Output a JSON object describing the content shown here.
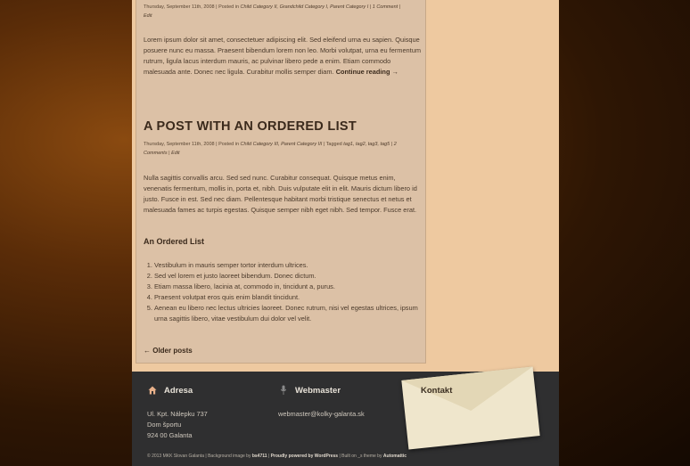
{
  "post1": {
    "meta_date": "Thursday, September 11th, 2008 | Posted in ",
    "meta_cats": "Child Category II, Grandchild Category I, Parent Category I",
    "meta_sep": " | ",
    "meta_comments": "1 Comment",
    "meta_edit": "Edit",
    "excerpt": "Lorem ipsum dolor sit amet, consectetuer adipiscing elit. Sed eleifend urna eu sapien. Quisque posuere nunc eu massa. Praesent bibendum lorem non leo. Morbi volutpat, urna eu fermentum rutrum, ligula lacus interdum mauris, ac pulvinar libero pede a enim. Etiam commodo malesuada ante. Donec nec ligula. Curabitur mollis semper diam.",
    "more_link": "Continue reading →"
  },
  "post2": {
    "title": "A POST WITH AN ORDERED LIST",
    "meta_date": "Thursday, September 11th, 2008 | Posted in ",
    "meta_cats": "Child Category III, Parent Category III",
    "meta_tagged": " | Tagged ",
    "meta_tags": "tag1, tag2, tag3, tag5",
    "meta_comments": "2 Comments",
    "meta_edit": "Edit",
    "body": "Nulla sagittis convallis arcu. Sed sed nunc. Curabitur consequat. Quisque metus enim, venenatis fermentum, mollis in, porta et, nibh. Duis vulputate elit in elit. Mauris dictum libero id justo. Fusce in est. Sed nec diam. Pellentesque habitant morbi tristique senectus et netus et malesuada fames ac turpis egestas. Quisque semper nibh eget nibh. Sed tempor. Fusce erat.",
    "subheading": "An Ordered List",
    "list": [
      "Vestibulum in mauris semper tortor interdum ultrices.",
      "Sed vel lorem et justo laoreet bibendum. Donec dictum.",
      "Etiam massa libero, lacinia at, commodo in, tincidunt a, purus.",
      "Praesent volutpat eros quis enim blandit tincidunt.",
      "Aenean eu libero nec lectus ultricies laoreet. Donec rutrum, nisi vel egestas ultrices, ipsum urna sagittis libero, vitae vestibulum dui dolor vel velit."
    ]
  },
  "nav": {
    "older_posts": "← Older posts"
  },
  "footer": {
    "address_title": "Adresa",
    "address_lines": [
      "Ul. Kpt. Nálepku 737",
      "Dom športu",
      "924 00 Galanta"
    ],
    "webmaster_title": "Webmaster",
    "webmaster_email": "webmaster@kolky-galanta.sk",
    "contact_title": "Kontakt",
    "copyright_pre": "© 2013 MKK Slovan Galanta | Background image by ",
    "copyright_bs": "bs4711",
    "copyright_mid1": " | ",
    "copyright_wp": "Proudly powered by WordPress",
    "copyright_mid2": " | Built on _s theme by ",
    "copyright_auto": "Automattic"
  },
  "icons": [
    "home-icon",
    "microphone-icon",
    "envelope-icon"
  ]
}
